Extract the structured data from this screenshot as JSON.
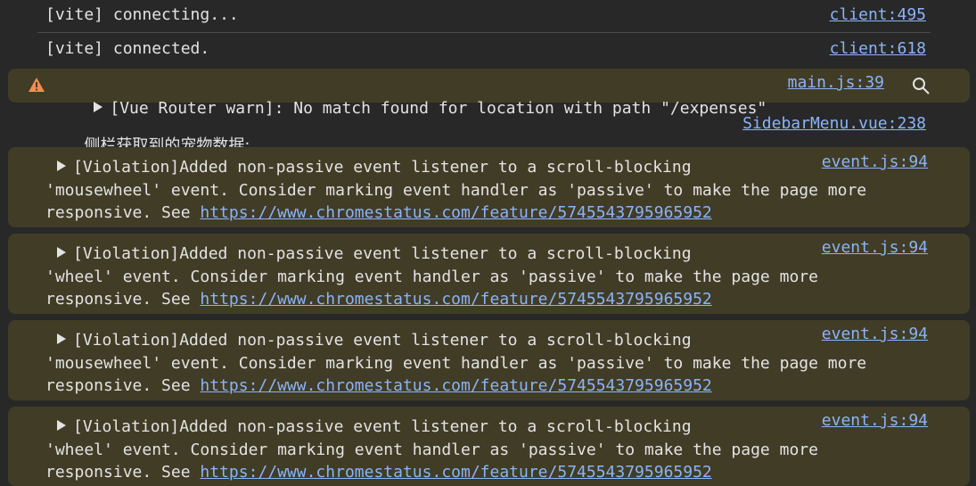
{
  "log": [
    {
      "text": "[vite] connecting...",
      "source": "client:495"
    },
    {
      "text": "[vite] connected.",
      "source": "client:618"
    }
  ],
  "warning": {
    "text": "[Vue Router warn]: No match found for location with path \"/expenses\"",
    "source": "main.js:39",
    "icon": "warning-triangle-icon",
    "zoom_icon": "magnifier-icon"
  },
  "sidebar_log": {
    "label": "侧栏获取到的宠物数据:",
    "value": "[{…}]",
    "source": "SidebarMenu.vue:238"
  },
  "violations": [
    {
      "line1": "[Violation]Added non-passive event listener to a scroll-blocking",
      "line2": "'mousewheel' event. Consider marking event handler as 'passive' to make the page more",
      "line3_prefix": "responsive. See ",
      "url": "https://www.chromestatus.com/feature/5745543795965952",
      "source": "event.js:94"
    },
    {
      "line1": "[Violation]Added non-passive event listener to a scroll-blocking",
      "line2": "'wheel' event. Consider marking event handler as 'passive' to make the page more",
      "line3_prefix": "responsive. See ",
      "url": "https://www.chromestatus.com/feature/5745543795965952",
      "source": "event.js:94"
    },
    {
      "line1": "[Violation]Added non-passive event listener to a scroll-blocking",
      "line2": "'mousewheel' event. Consider marking event handler as 'passive' to make the page more",
      "line3_prefix": "responsive. See ",
      "url": "https://www.chromestatus.com/feature/5745543795965952",
      "source": "event.js:94"
    },
    {
      "line1": "[Violation]Added non-passive event listener to a scroll-blocking",
      "line2": "'wheel' event. Consider marking event handler as 'passive' to make the page more",
      "line3_prefix": "responsive. See ",
      "url": "https://www.chromestatus.com/feature/5745543795965952",
      "source": "event.js:94"
    }
  ],
  "colors": {
    "background": "#282828",
    "warning_background": "#413c26",
    "link": "#8ab4f8",
    "warning_icon": "#f28b54"
  }
}
